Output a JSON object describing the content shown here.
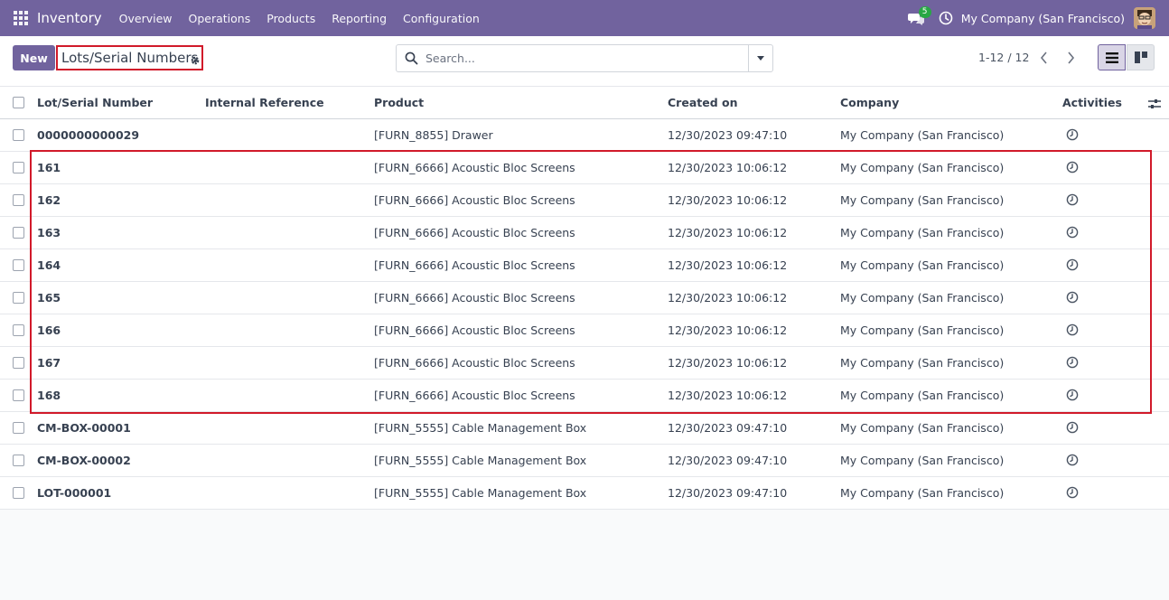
{
  "navbar": {
    "app_name": "Inventory",
    "menu": [
      "Overview",
      "Operations",
      "Products",
      "Reporting",
      "Configuration"
    ],
    "chat_badge": "5",
    "company": "My Company (San Francisco)"
  },
  "control": {
    "new_label": "New",
    "title": "Lots/Serial Numbers",
    "search_placeholder": "Search...",
    "pager": "1-12 / 12"
  },
  "table": {
    "headers": [
      "Lot/Serial Number",
      "Internal Reference",
      "Product",
      "Created on",
      "Company",
      "Activities"
    ],
    "rows": [
      {
        "lot": "0000000000029",
        "ref": "",
        "product": "[FURN_8855] Drawer",
        "created": "12/30/2023 09:47:10",
        "company": "My Company (San Francisco)"
      },
      {
        "lot": "161",
        "ref": "",
        "product": "[FURN_6666] Acoustic Bloc Screens",
        "created": "12/30/2023 10:06:12",
        "company": "My Company (San Francisco)"
      },
      {
        "lot": "162",
        "ref": "",
        "product": "[FURN_6666] Acoustic Bloc Screens",
        "created": "12/30/2023 10:06:12",
        "company": "My Company (San Francisco)"
      },
      {
        "lot": "163",
        "ref": "",
        "product": "[FURN_6666] Acoustic Bloc Screens",
        "created": "12/30/2023 10:06:12",
        "company": "My Company (San Francisco)"
      },
      {
        "lot": "164",
        "ref": "",
        "product": "[FURN_6666] Acoustic Bloc Screens",
        "created": "12/30/2023 10:06:12",
        "company": "My Company (San Francisco)"
      },
      {
        "lot": "165",
        "ref": "",
        "product": "[FURN_6666] Acoustic Bloc Screens",
        "created": "12/30/2023 10:06:12",
        "company": "My Company (San Francisco)"
      },
      {
        "lot": "166",
        "ref": "",
        "product": "[FURN_6666] Acoustic Bloc Screens",
        "created": "12/30/2023 10:06:12",
        "company": "My Company (San Francisco)"
      },
      {
        "lot": "167",
        "ref": "",
        "product": "[FURN_6666] Acoustic Bloc Screens",
        "created": "12/30/2023 10:06:12",
        "company": "My Company (San Francisco)"
      },
      {
        "lot": "168",
        "ref": "",
        "product": "[FURN_6666] Acoustic Bloc Screens",
        "created": "12/30/2023 10:06:12",
        "company": "My Company (San Francisco)"
      },
      {
        "lot": "CM-BOX-00001",
        "ref": "",
        "product": "[FURN_5555] Cable Management Box",
        "created": "12/30/2023 09:47:10",
        "company": "My Company (San Francisco)"
      },
      {
        "lot": "CM-BOX-00002",
        "ref": "",
        "product": "[FURN_5555] Cable Management Box",
        "created": "12/30/2023 09:47:10",
        "company": "My Company (San Francisco)"
      },
      {
        "lot": "LOT-000001",
        "ref": "",
        "product": "[FURN_5555] Cable Management Box",
        "created": "12/30/2023 09:47:10",
        "company": "My Company (San Francisco)"
      }
    ]
  },
  "colors": {
    "brand": "#71639e",
    "highlight": "#d11a2a",
    "badge": "#28a745"
  },
  "icons": [
    "apps-grid-icon",
    "chat-icon",
    "clock-icon",
    "gear-icon",
    "search-icon",
    "chevron-left-icon",
    "chevron-right-icon",
    "list-view-icon",
    "kanban-view-icon",
    "activity-clock-icon",
    "column-adjust-icon"
  ]
}
